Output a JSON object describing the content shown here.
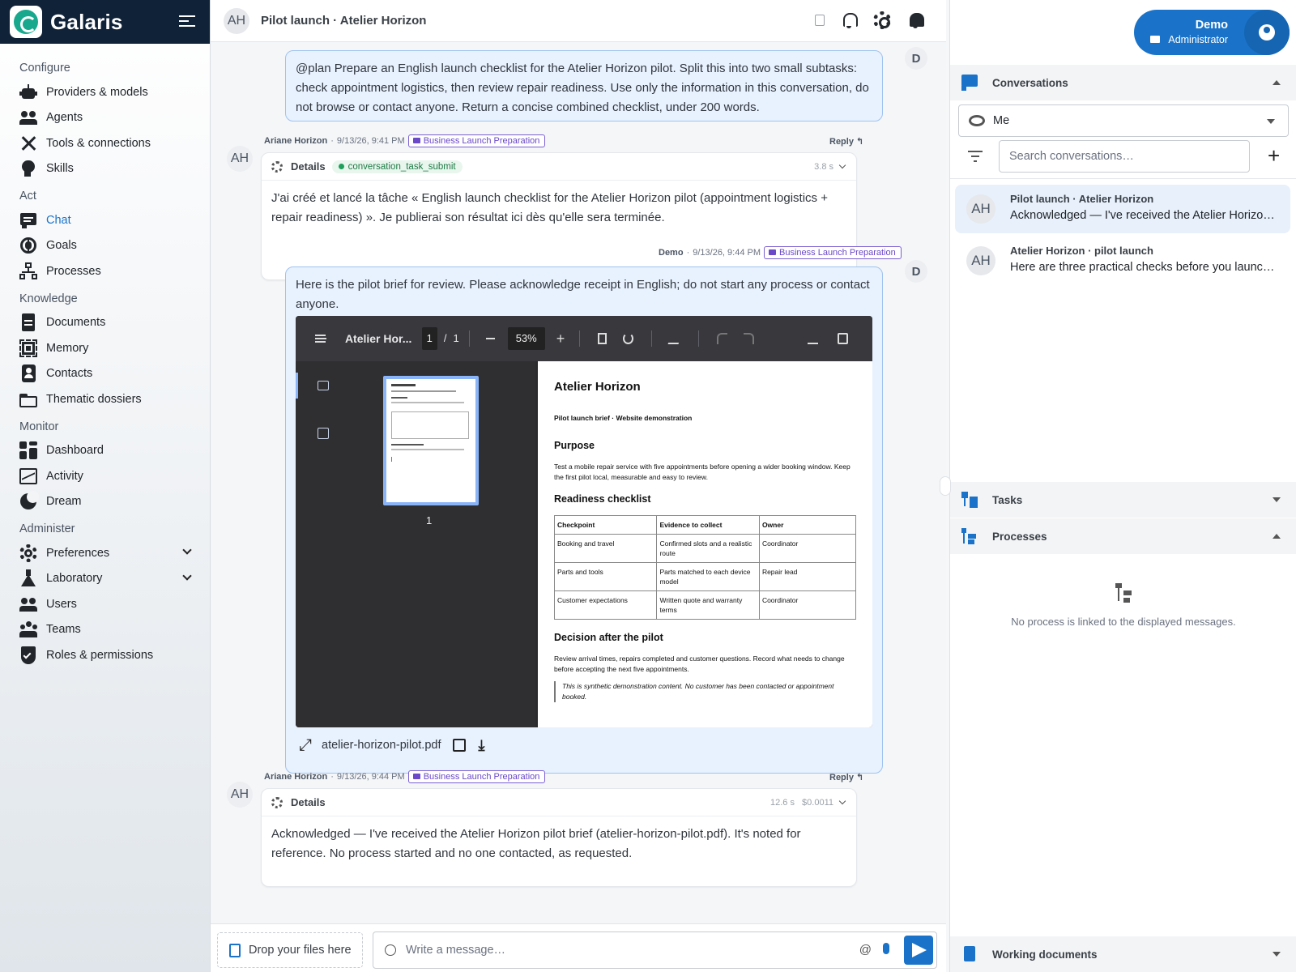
{
  "app": {
    "name": "Galaris"
  },
  "sidebar": {
    "sections": [
      {
        "title": "Configure",
        "items": [
          {
            "label": "Providers & models",
            "icon": "robot-icon"
          },
          {
            "label": "Agents",
            "icon": "agents-icon"
          },
          {
            "label": "Tools & connections",
            "icon": "tools-icon"
          },
          {
            "label": "Skills",
            "icon": "skills-icon"
          }
        ]
      },
      {
        "title": "Act",
        "items": [
          {
            "label": "Chat",
            "icon": "chat-icon",
            "active": true
          },
          {
            "label": "Goals",
            "icon": "goals-icon"
          },
          {
            "label": "Processes",
            "icon": "processes-icon"
          }
        ]
      },
      {
        "title": "Knowledge",
        "items": [
          {
            "label": "Documents",
            "icon": "document-icon"
          },
          {
            "label": "Memory",
            "icon": "memory-chip-icon"
          },
          {
            "label": "Contacts",
            "icon": "contacts-icon"
          },
          {
            "label": "Thematic dossiers",
            "icon": "folder-icon"
          }
        ]
      },
      {
        "title": "Monitor",
        "items": [
          {
            "label": "Dashboard",
            "icon": "dashboard-icon"
          },
          {
            "label": "Activity",
            "icon": "activity-icon"
          },
          {
            "label": "Dream",
            "icon": "moon-icon"
          }
        ]
      },
      {
        "title": "Administer",
        "items": [
          {
            "label": "Preferences",
            "icon": "gear-icon",
            "expandable": true
          },
          {
            "label": "Laboratory",
            "icon": "flask-icon",
            "expandable": true
          },
          {
            "label": "Users",
            "icon": "users-icon"
          },
          {
            "label": "Teams",
            "icon": "teams-icon"
          },
          {
            "label": "Roles & permissions",
            "icon": "shield-icon"
          }
        ]
      }
    ]
  },
  "chat": {
    "header": {
      "avatar": "AH",
      "title": "Pilot launch · Atelier Horizon"
    },
    "messages": [
      {
        "text": "@plan Prepare an English launch checklist for the Atelier Horizon pilot. Split this into two small subtasks: check appointment logistics, then review repair readiness. Use only the information in this conversation, do not browse or contact anyone. Return a concise combined checklist, under 200 words.",
        "avatar": "D"
      },
      {
        "author": "Ariane Horizon",
        "time": "9/13/26, 9:41 PM",
        "tag": "Business Launch Preparation",
        "reply": "Reply ↰",
        "details": "Details",
        "chip": "conversation_task_submit",
        "duration": "3.8 s",
        "avatar": "AH",
        "text": "J'ai créé et lancé la tâche « English launch checklist for the Atelier Horizon pilot (appointment logistics + repair readiness) ». Je publierai son résultat ici dès qu'elle sera terminée."
      },
      {
        "author": "Demo",
        "time": "9/13/26, 9:44 PM",
        "tag": "Business Launch Preparation",
        "avatar": "D",
        "text": "Here is the pilot brief for review. Please acknowledge receipt in English; do not start any process or contact anyone."
      },
      {
        "author": "Ariane Horizon",
        "time": "9/13/26, 9:44 PM",
        "tag": "Business Launch Preparation",
        "reply": "Reply ↰",
        "details": "Details",
        "duration": "12.6 s",
        "cost": "$0.0011",
        "avatar": "AH",
        "text": "Acknowledged — I've received the Atelier Horizon pilot brief (atelier-horizon-pilot.pdf). It's noted for reference. No process started and no one contacted, as requested."
      }
    ],
    "pdf": {
      "title": "Atelier Hor...",
      "page": "1",
      "sep": "/",
      "pages": "1",
      "zoom": "53%",
      "thumb_label": "1",
      "filename": "atelier-horizon-pilot.pdf",
      "doc": {
        "h1": "Atelier Horizon",
        "subtitle": "Pilot launch brief · Website demonstration",
        "purpose_h": "Purpose",
        "purpose": "Test a mobile repair service with five appointments before opening a wider booking window. Keep the first pilot local, measurable and easy to review.",
        "checklist_h": "Readiness checklist",
        "cols": [
          "Checkpoint",
          "Evidence to collect",
          "Owner"
        ],
        "rows": [
          [
            "Booking and travel",
            "Confirmed slots and a realistic route",
            "Coordinator"
          ],
          [
            "Parts and tools",
            "Parts matched to each device model",
            "Repair lead"
          ],
          [
            "Customer expectations",
            "Written quote and warranty terms",
            "Coordinator"
          ]
        ],
        "decision_h": "Decision after the pilot",
        "decision": "Review arrival times, repairs completed and customer questions. Record what needs to change before accepting the next five appointments.",
        "note": "This is synthetic demonstration content. No customer has been contacted or appointment booked."
      }
    },
    "composer": {
      "drop": "Drop your files here",
      "placeholder": "Write a message…"
    }
  },
  "right": {
    "user": {
      "name": "Demo",
      "role": "Administrator"
    },
    "conversations": {
      "title": "Conversations",
      "filter": "Me",
      "search_placeholder": "Search conversations…",
      "items": [
        {
          "avatar": "AH",
          "title": "Pilot launch · Atelier Horizon",
          "preview": "Acknowledged — I've received the Atelier Horizon pilot brief (atelier-horizon-pilot.pdf).",
          "selected": true
        },
        {
          "avatar": "AH",
          "title": "Atelier Horizon · pilot launch",
          "preview": "Here are three practical checks before you launch the pilot."
        }
      ]
    },
    "tasks": {
      "title": "Tasks"
    },
    "processes": {
      "title": "Processes",
      "empty": "No process is linked to the displayed messages."
    },
    "working_docs": {
      "title": "Working documents"
    }
  },
  "colors": {
    "accent": "#1a73c8",
    "brand_bar": "#0f2238",
    "tag": "#6a48c7",
    "chip": "#1e7a45"
  }
}
